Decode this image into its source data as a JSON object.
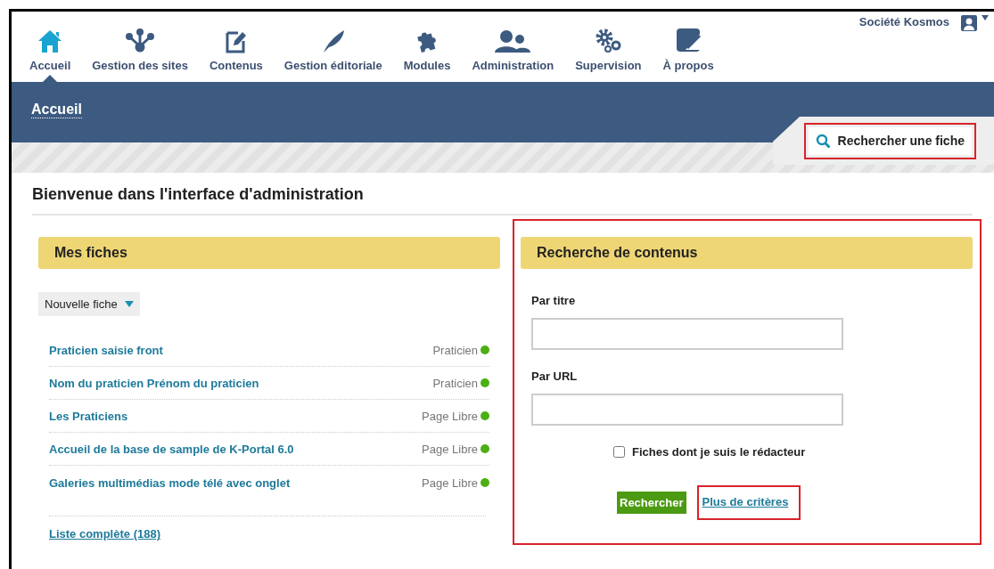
{
  "nav": {
    "items": [
      {
        "label": "Accueil",
        "selected": true
      },
      {
        "label": "Gestion des sites",
        "selected": false
      },
      {
        "label": "Contenus",
        "selected": false
      },
      {
        "label": "Gestion éditoriale",
        "selected": false
      },
      {
        "label": "Modules",
        "selected": false
      },
      {
        "label": "Administration",
        "selected": false
      },
      {
        "label": "Supervision",
        "selected": false
      },
      {
        "label": "À propos",
        "selected": false
      }
    ],
    "user": "Société Kosmos"
  },
  "banner": {
    "title": "Accueil",
    "search_tab": "Rechercher une fiche"
  },
  "page_title": "Bienvenue dans l'interface d'administration",
  "my_items": {
    "title": "Mes fiches",
    "new_button": "Nouvelle fiche",
    "rows": [
      {
        "title": "Praticien saisie front",
        "type": "Praticien",
        "color": "#4caf14"
      },
      {
        "title": "Nom du praticien Prénom du praticien",
        "type": "Praticien",
        "color": "#4caf14"
      },
      {
        "title": "Les Praticiens",
        "type": "Page Libre",
        "color": "#4caf14"
      },
      {
        "title": "Accueil de la base de sample de K-Portal 6.0",
        "type": "Page Libre",
        "color": "#4caf14"
      },
      {
        "title": "Galeries multimédias mode télé avec onglet",
        "type": "Page Libre",
        "color": "#4caf14"
      }
    ],
    "full_list": "Liste complète (188)"
  },
  "search": {
    "title": "Recherche de contenus",
    "fields": [
      {
        "label": "Par titre"
      },
      {
        "label": "Par URL"
      }
    ],
    "checkbox": {
      "label": "Fiches dont je suis le rédacteur",
      "checked": false
    },
    "submit": "Rechercher",
    "more": "Plus de critères"
  }
}
